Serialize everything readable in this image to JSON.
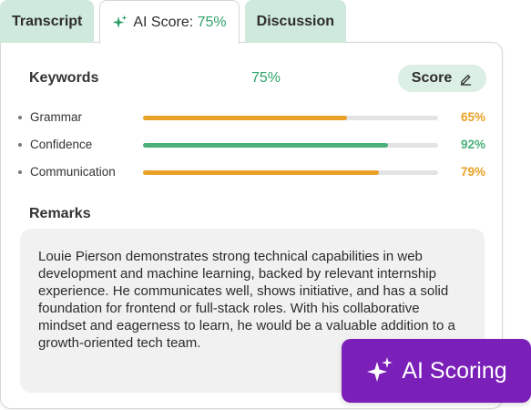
{
  "tabs": [
    {
      "label": "Transcript"
    },
    {
      "label": "AI Score: ",
      "pct": "75%"
    },
    {
      "label": "Discussion"
    }
  ],
  "keywords": {
    "title": "Keywords",
    "total": "75%",
    "score_button": "Score"
  },
  "metrics": [
    {
      "label": "Grammar",
      "value": "65%",
      "fill": 0.69,
      "color": "#e9a126"
    },
    {
      "label": "Confidence",
      "value": "92%",
      "fill": 0.83,
      "color": "#4bb07a"
    },
    {
      "label": "Communication",
      "value": "79%",
      "fill": 0.8,
      "color": "#e9a126"
    }
  ],
  "remarks": {
    "title": "Remarks",
    "text": "Louie Pierson demonstrates strong technical capabilities in web development and machine learning, backed by relevant internship experience. He communicates well, shows initiative, and has a solid foundation for frontend or full-stack roles. With his collaborative mindset and eagerness to learn, he would be a valuable addition to a growth-oriented tech team."
  },
  "badge": {
    "label": "AI Scoring"
  },
  "colors": {
    "accent_green": "#2fa36b",
    "tab_bg": "#cfe9dc",
    "badge_purple": "#7a1fb8",
    "bar_orange": "#e9a126"
  }
}
